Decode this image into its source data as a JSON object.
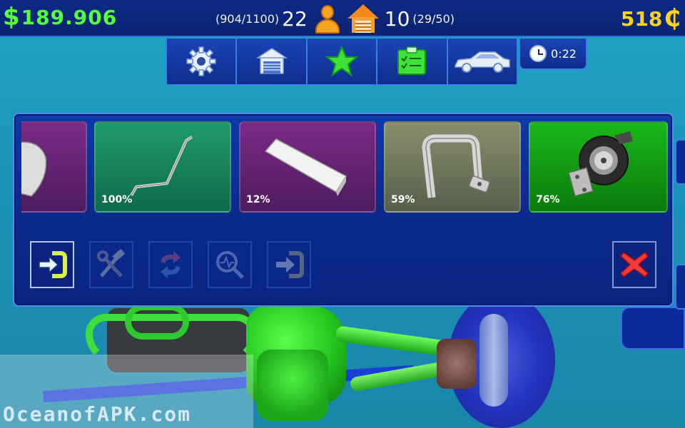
{
  "hud": {
    "money_symbol": "$",
    "money": "189.906",
    "xp_progress": "(904/1100)",
    "level": "22",
    "garage_count": "10",
    "garage_capacity": "(29/50)",
    "coins": "518",
    "coin_symbol": "₵"
  },
  "tabs": [
    {
      "id": "settings",
      "icon": "gear-icon"
    },
    {
      "id": "garage",
      "icon": "garage-icon"
    },
    {
      "id": "favorites",
      "icon": "star-icon"
    },
    {
      "id": "tasks",
      "icon": "clipboard-icon"
    },
    {
      "id": "cars",
      "icon": "car-icon"
    }
  ],
  "timer": {
    "value": "0:22"
  },
  "parts": [
    {
      "name": "partial-part",
      "color": "purple",
      "percent": ""
    },
    {
      "name": "rod-part",
      "color": "teal",
      "percent": "100%",
      "condition": 1.0
    },
    {
      "name": "bar-part",
      "color": "purple",
      "percent": "12%",
      "condition": 0.12
    },
    {
      "name": "pipe-part",
      "color": "olive",
      "percent": "59%",
      "condition": 0.59
    },
    {
      "name": "turbo-part",
      "color": "green",
      "percent": "76%",
      "condition": 0.76
    }
  ],
  "actions": [
    {
      "icon": "install-icon",
      "enabled": true
    },
    {
      "icon": "repair-tools-icon",
      "enabled": false
    },
    {
      "icon": "swap-icon",
      "enabled": false
    },
    {
      "icon": "inspect-icon",
      "enabled": false
    },
    {
      "icon": "move-icon",
      "enabled": false
    }
  ],
  "watermark": "OceanofAPK.com",
  "colors": {
    "money": "#55ff3c",
    "coins": "#ffd21a",
    "panel": "#0b2a8c",
    "accent_border": "#4d8df0"
  }
}
